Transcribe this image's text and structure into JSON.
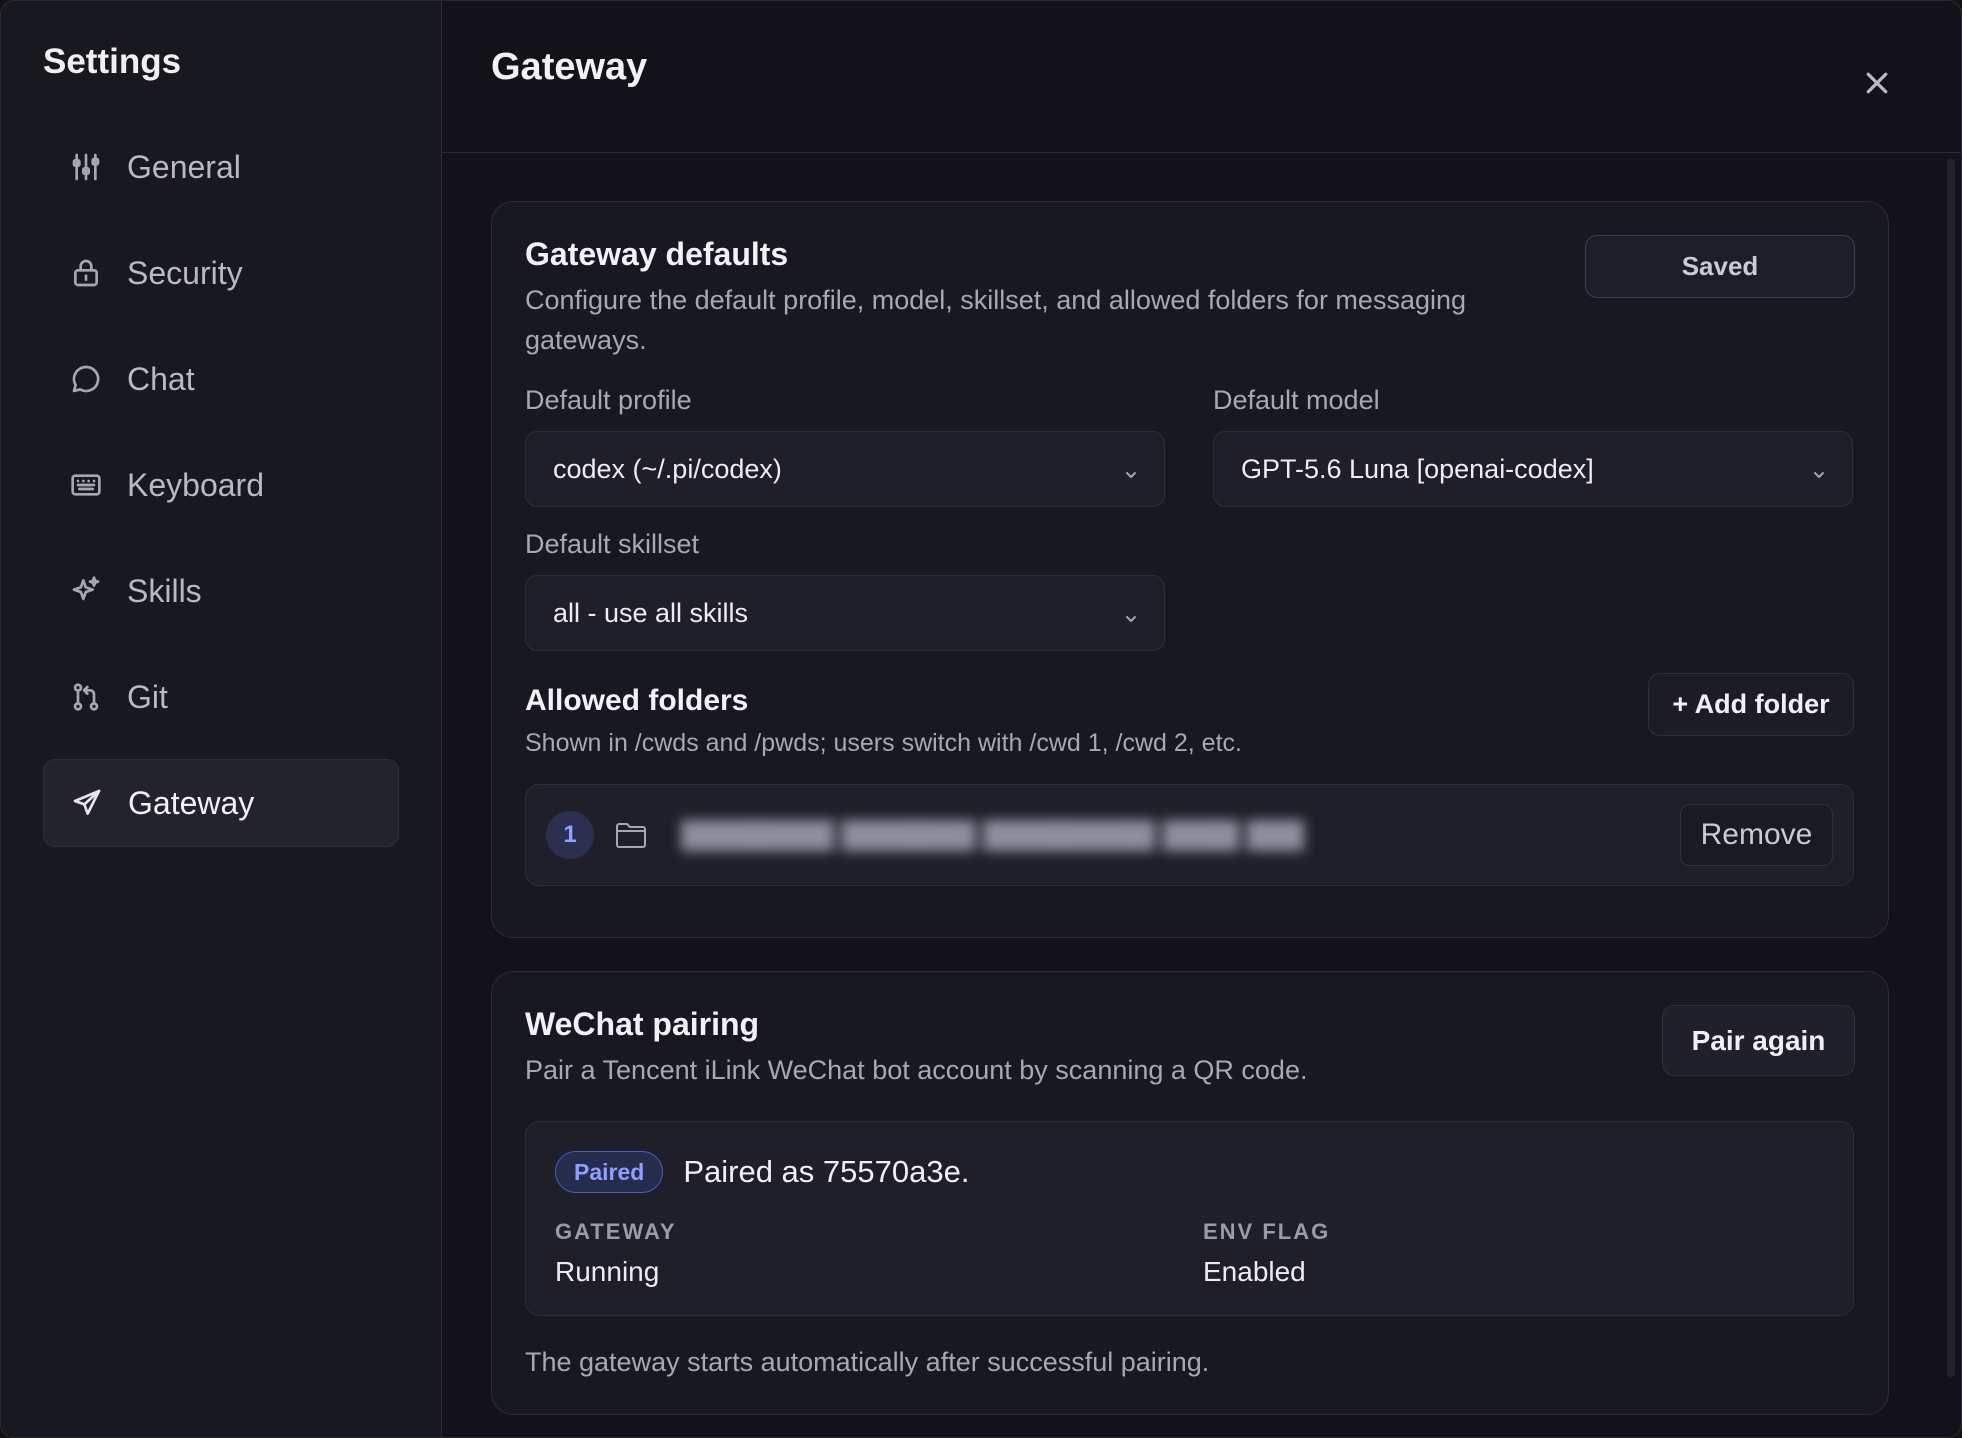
{
  "sidebar": {
    "title": "Settings",
    "items": [
      {
        "label": "General",
        "icon": "sliders-icon"
      },
      {
        "label": "Security",
        "icon": "lock-icon"
      },
      {
        "label": "Chat",
        "icon": "chat-bubble-icon"
      },
      {
        "label": "Keyboard",
        "icon": "keyboard-icon"
      },
      {
        "label": "Skills",
        "icon": "sparkle-icon"
      },
      {
        "label": "Git",
        "icon": "git-icon"
      },
      {
        "label": "Gateway",
        "icon": "send-icon",
        "active": true
      }
    ]
  },
  "header": {
    "title": "Gateway",
    "close_icon": "close-icon"
  },
  "defaults": {
    "title": "Gateway defaults",
    "description": "Configure the default profile, model, skillset, and allowed folders for messaging gateways.",
    "save_label": "Saved",
    "profile_label": "Default profile",
    "profile_value": "codex (~/.pi/codex)",
    "model_label": "Default model",
    "model_value": "GPT-5.6 Luna [openai-codex]",
    "skillset_label": "Default skillset",
    "skillset_value": "all - use all skills",
    "folders": {
      "title": "Allowed folders",
      "description": "Shown in /cwds and /pwds; users switch with /cwd 1, /cwd 2, etc.",
      "add_label": "+ Add folder",
      "items": [
        {
          "index": "1",
          "remove_label": "Remove"
        }
      ]
    }
  },
  "wechat": {
    "title": "WeChat pairing",
    "description": "Pair a Tencent iLink WeChat bot account by scanning a QR code.",
    "pair_label": "Pair again",
    "badge": "Paired",
    "paired_text": "Paired as 75570a3e.",
    "gateway_label": "GATEWAY",
    "gateway_value": "Running",
    "env_label": "ENV FLAG",
    "env_value": "Enabled",
    "footnote": "The gateway starts automatically after successful pairing."
  },
  "colors": {
    "background": "#121218",
    "sidebar": "#18181f",
    "accent": "#8ea0ff",
    "badge_bg": "#262c4d"
  }
}
